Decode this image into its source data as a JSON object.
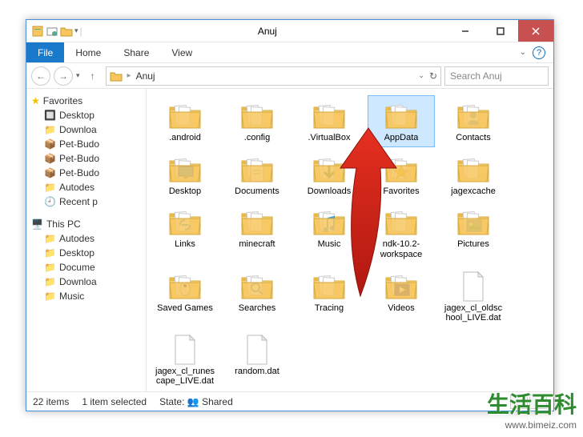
{
  "window": {
    "title": "Anuj"
  },
  "ribbon": {
    "file": "File",
    "tabs": [
      "Home",
      "Share",
      "View"
    ]
  },
  "address": {
    "root_icon": "folder",
    "crumbs": [
      "Anuj"
    ],
    "search_placeholder": "Search Anuj"
  },
  "sidebar": {
    "favorites": {
      "label": "Favorites",
      "items": [
        "Desktop",
        "Downloa",
        "Pet-Budo",
        "Pet-Budo",
        "Pet-Budo",
        "Autodes",
        "Recent p"
      ]
    },
    "thispc": {
      "label": "This PC",
      "items": [
        "Autodes",
        "Desktop",
        "Docume",
        "Downloa",
        "Music"
      ]
    }
  },
  "items": [
    {
      "name": ".android",
      "type": "folder"
    },
    {
      "name": ".config",
      "type": "folder"
    },
    {
      "name": ".VirtualBox",
      "type": "folder"
    },
    {
      "name": "AppData",
      "type": "folder",
      "selected": true
    },
    {
      "name": "Contacts",
      "type": "folder_contacts"
    },
    {
      "name": "Desktop",
      "type": "folder_desktop"
    },
    {
      "name": "Documents",
      "type": "folder_docs"
    },
    {
      "name": "Downloads",
      "type": "folder_down"
    },
    {
      "name": "Favorites",
      "type": "folder_fav"
    },
    {
      "name": "jagexcache",
      "type": "folder"
    },
    {
      "name": "Links",
      "type": "folder_links"
    },
    {
      "name": "minecraft",
      "type": "folder"
    },
    {
      "name": "Music",
      "type": "folder_music"
    },
    {
      "name": "ndk-10.2-workspace",
      "type": "folder"
    },
    {
      "name": "Pictures",
      "type": "folder_pics"
    },
    {
      "name": "Saved Games",
      "type": "folder_games"
    },
    {
      "name": "Searches",
      "type": "folder_search"
    },
    {
      "name": "Tracing",
      "type": "folder"
    },
    {
      "name": "Videos",
      "type": "folder_video"
    },
    {
      "name": "jagex_cl_oldschool_LIVE.dat",
      "type": "file"
    },
    {
      "name": "jagex_cl_runescape_LIVE.dat",
      "type": "file"
    },
    {
      "name": "random.dat",
      "type": "file"
    }
  ],
  "status": {
    "count": "22 items",
    "selected": "1 item selected",
    "state_label": "State:",
    "state_value": "Shared"
  },
  "watermark": {
    "cn": "生活百科",
    "url": "www.bimeiz.com"
  }
}
